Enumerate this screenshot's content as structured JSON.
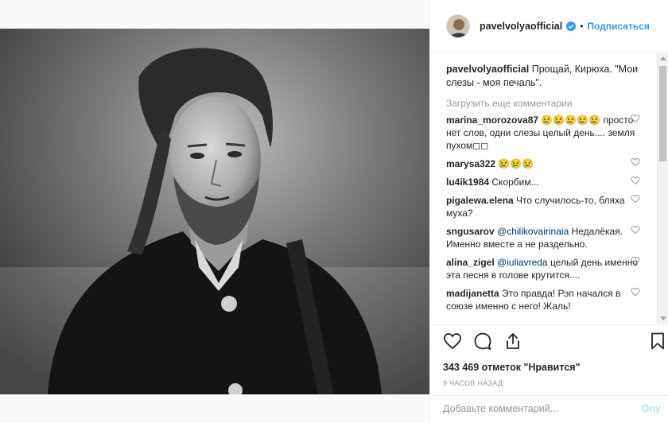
{
  "post": {
    "author": "pavelvolyaofficial",
    "follow_label": "Подписаться",
    "separator": "•",
    "caption": "Прощай, Кирюха. \"Мои слезы - моя печаль\".",
    "load_more": "Загрузить еще комментарии",
    "likes": "343 469 отметок \"Нравится\"",
    "time": "9 часов назад",
    "comment_placeholder": "Добавьте комментарий...",
    "post_label": "Опу"
  },
  "comments": [
    {
      "user": "marina_morozova87",
      "text": "😢😢😢😢😢 просто нет слов, одни слезы целый день.... земля пухом◻◻"
    },
    {
      "user": "marysa322",
      "text": "😢😢😢"
    },
    {
      "user": "lu4ik1984",
      "text": "Скорбим..."
    },
    {
      "user": "pigalewa.elena",
      "text": "Что случилось-то, бляха муха?"
    },
    {
      "user": "sngusarov",
      "mention": "@chilikovairinaia",
      "text": "Недалёкая. Именно вместе а не раздельно."
    },
    {
      "user": "alina_zigel",
      "mention": "@iuliavreda",
      "text": "целый день именно эта песня в голове крутится...."
    },
    {
      "user": "madijanetta",
      "text": "Это правда! Рэп начался в союзе именно с него! Жаль!"
    }
  ],
  "colors": {
    "link": "#3897f0",
    "verified": "#3897f0",
    "mention": "#003569",
    "muted": "#999999"
  },
  "icons": [
    "heart-icon",
    "comment-icon",
    "share-icon",
    "bookmark-icon",
    "verified-badge-icon"
  ]
}
